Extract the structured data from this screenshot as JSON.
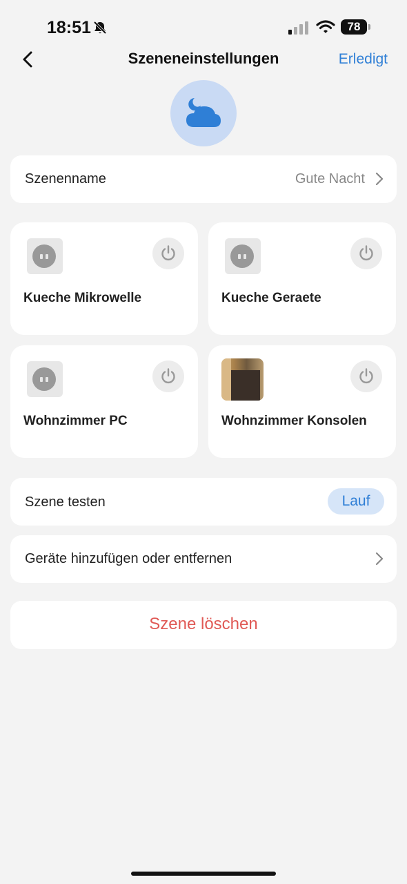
{
  "status_bar": {
    "time": "18:51",
    "battery": "78"
  },
  "nav": {
    "title": "Szeneneinstellungen",
    "done_label": "Erledigt"
  },
  "scene_name_row": {
    "label": "Szenenname",
    "value": "Gute Nacht"
  },
  "devices": [
    {
      "name": "Kueche Mikrowelle",
      "icon": "plug-icon"
    },
    {
      "name": "Kueche Geraete",
      "icon": "plug-icon"
    },
    {
      "name": "Wohnzimmer PC",
      "icon": "plug-icon"
    },
    {
      "name": "Wohnzimmer Konsolen",
      "icon": "device-photo"
    }
  ],
  "test_row": {
    "label": "Szene testen",
    "button_label": "Lauf"
  },
  "manage_row": {
    "label": "Geräte hinzufügen oder entfernen"
  },
  "delete_label": "Szene löschen",
  "colors": {
    "accent": "#2f7fd6",
    "danger": "#e05a56",
    "background": "#f3f3f3",
    "scene_icon_bg": "#c9daf4"
  }
}
